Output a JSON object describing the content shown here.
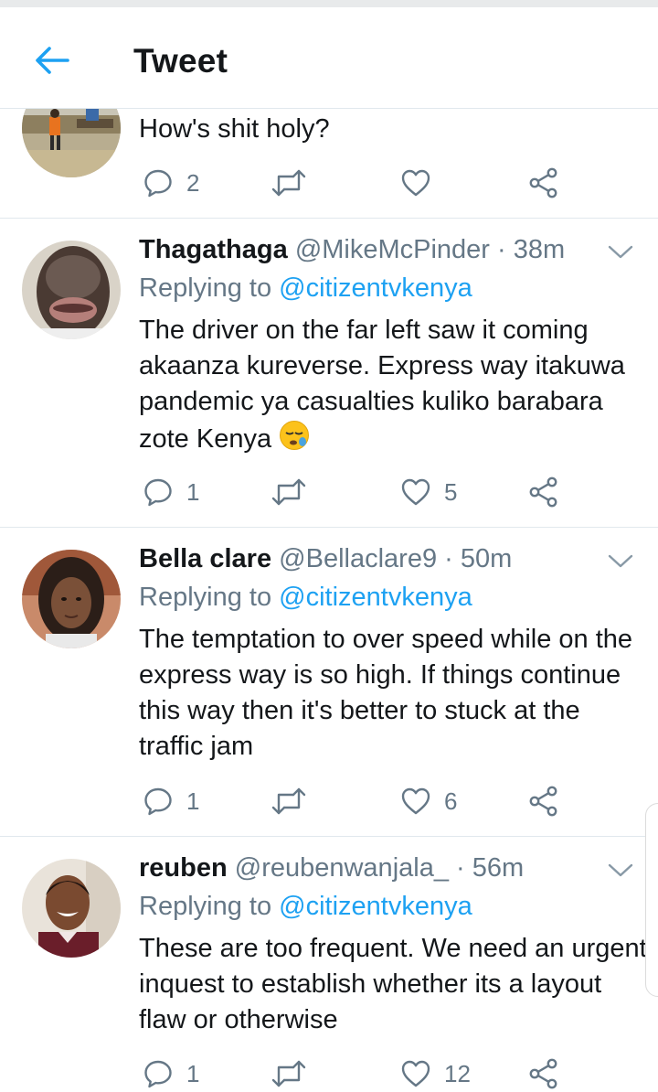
{
  "header": {
    "title": "Tweet",
    "back_icon": "arrow-left-icon",
    "accent_color": "#1da1f2"
  },
  "tweets": [
    {
      "text": "How's shit holy?",
      "reply_count": "2",
      "retweet_count": "",
      "like_count": ""
    },
    {
      "name": "Thagathaga",
      "handle": "@MikeMcPinder",
      "time": "· 38m",
      "replying_prefix": "Replying to",
      "replying_to": "@citizentvkenya",
      "text": "The driver on the far left saw it coming akaanza kureverse. Express way itakuwa pandemic ya casualties kuliko barabara zote Kenya",
      "emoji": "sleepy-face-emoji",
      "reply_count": "1",
      "retweet_count": "",
      "like_count": "5"
    },
    {
      "name": "Bella clare",
      "handle": "@Bellaclare9",
      "time": "· 50m",
      "replying_prefix": "Replying to",
      "replying_to": "@citizentvkenya",
      "text": "The temptation to over speed while on the express way is so high. If things continue this way then it's better to stuck at the traffic jam",
      "reply_count": "1",
      "retweet_count": "",
      "like_count": "6"
    },
    {
      "name": "reuben",
      "handle": "@reubenwanjala_",
      "time": "· 56m",
      "replying_prefix": "Replying to",
      "replying_to": "@citizentvkenya",
      "text": "These are too frequent. We need an urgent inquest to establish whether its a layout flaw or otherwise",
      "reply_count": "1",
      "retweet_count": "",
      "like_count": "12"
    }
  ],
  "icons": {
    "reply": "reply-bubble-icon",
    "retweet": "retweet-icon",
    "like": "heart-icon",
    "share": "share-icon",
    "more": "chevron-down-icon"
  },
  "colors": {
    "text_primary": "#14171a",
    "text_secondary": "#657786",
    "link": "#1da1f2",
    "divider": "#e1e8ed"
  }
}
